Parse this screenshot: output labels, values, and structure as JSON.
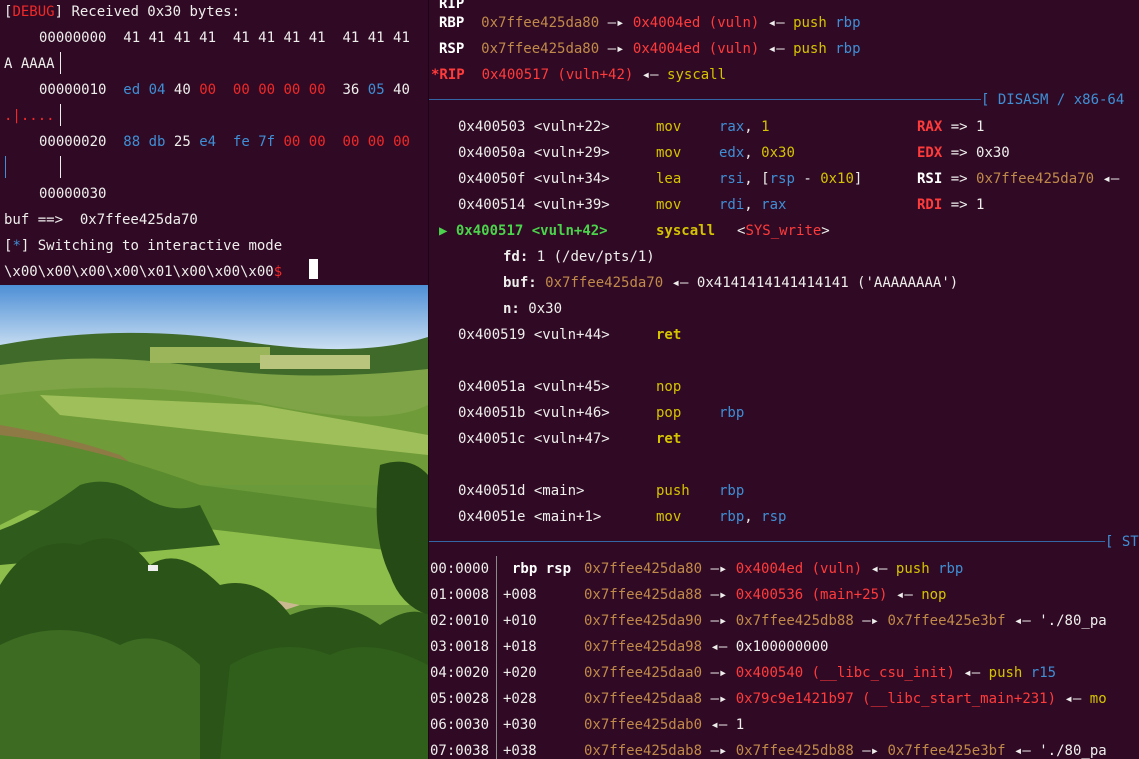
{
  "left_terminal": {
    "debug_open": "[",
    "debug_tag": "DEBUG",
    "debug_rest": "] Received 0x30 bytes:",
    "hex_lines": [
      {
        "offset": "00000000",
        "bytes": "41 41 41 41  41 41 41 41  41 41 41",
        "ascii": "A AAAA"
      },
      {
        "offset": "00000010",
        "b1": "ed 04",
        "b2": "40",
        "b3": "00",
        "b4": "00 00 00 00",
        "b5": "36",
        "b6": "05",
        "b7": "40",
        "ascii": ".|...."
      },
      {
        "offset": "00000020",
        "b1": "88 db",
        "b2": "25",
        "b3": "e4",
        "b4": "fe 7f",
        "b5": "00 00",
        "b6": "00 00 00"
      },
      {
        "offset": "00000030"
      }
    ],
    "buf_line": "buf ==>  0x7ffee425da70",
    "info_open": "[",
    "info_star": "*",
    "info_rest": "] Switching to interactive mode",
    "prompt_line": "\\x00\\x00\\x00\\x00\\x01\\x00\\x00\\x00",
    "prompt_sign": "$"
  },
  "right_terminal": {
    "registers": [
      {
        "name": "RBP",
        "addr": "0x7ffee425da80",
        "target": "0x4004ed (vuln)",
        "instr": "push",
        "arg": "rbp"
      },
      {
        "name": "RSP",
        "addr": "0x7ffee425da80",
        "target": "0x4004ed (vuln)",
        "instr": "push",
        "arg": "rbp"
      },
      {
        "name": "*RIP",
        "addr": "0x400517 (vuln+42)",
        "instr": "syscall"
      }
    ],
    "disasm_header": "[ DISASM / x86-64",
    "disasm": [
      {
        "addr": "0x400503",
        "sym": "<vuln+22>",
        "op": "mov",
        "args": "rax, 1",
        "reg": "RAX",
        "val": "1"
      },
      {
        "addr": "0x40050a",
        "sym": "<vuln+29>",
        "op": "mov",
        "args": "edx, 0x30",
        "reg": "EDX",
        "val": "0x30"
      },
      {
        "addr": "0x40050f",
        "sym": "<vuln+34>",
        "op": "lea",
        "args": "rsi, [rsp - 0x10]",
        "reg": "RSI",
        "val": "0x7ffee425da70"
      },
      {
        "addr": "0x400514",
        "sym": "<vuln+39>",
        "op": "mov",
        "args": "rdi, rax",
        "reg": "RDI",
        "val": "1"
      },
      {
        "addr": "0x400517",
        "sym": "<vuln+42>",
        "op": "syscall",
        "args": "<SYS_write>",
        "current": true
      },
      {
        "fd_label": "fd:",
        "fd_val": "1 (/dev/pts/1)"
      },
      {
        "buf_label": "buf:",
        "buf_addr": "0x7ffee425da70",
        "buf_val": "0x4141414141414141 ('AAAAAAAA')"
      },
      {
        "n_label": "n:",
        "n_val": "0x30"
      },
      {
        "addr": "0x400519",
        "sym": "<vuln+44>",
        "op": "ret"
      },
      {
        "addr": "0x40051a",
        "sym": "<vuln+45>",
        "op": "nop"
      },
      {
        "addr": "0x40051b",
        "sym": "<vuln+46>",
        "op": "pop",
        "args": "rbp"
      },
      {
        "addr": "0x40051c",
        "sym": "<vuln+47>",
        "op": "ret"
      },
      {
        "addr": "0x40051d",
        "sym": "<main>",
        "op": "push",
        "args": "rbp"
      },
      {
        "addr": "0x40051e",
        "sym": "<main+1>",
        "op": "mov",
        "args": "rbp, rsp"
      }
    ],
    "stack_header": "[ ST",
    "stack": [
      {
        "idx": "00:0000",
        "regs": "rbp rsp",
        "addr": "0x7ffee425da80",
        "t1": "0x4004ed (vuln)",
        "t2": "push rbp"
      },
      {
        "idx": "01:0008",
        "off": "+008",
        "addr": "0x7ffee425da88",
        "t1": "0x400536 (main+25)",
        "t2": "nop"
      },
      {
        "idx": "02:0010",
        "off": "+010",
        "addr": "0x7ffee425da90",
        "t1": "0x7ffee425db88",
        "t3": "0x7ffee425e3bf",
        "t4": "'./80_pa"
      },
      {
        "idx": "03:0018",
        "off": "+018",
        "addr": "0x7ffee425da98",
        "t5": "0x100000000"
      },
      {
        "idx": "04:0020",
        "off": "+020",
        "addr": "0x7ffee425daa0",
        "t1": "0x400540 (__libc_csu_init)",
        "t2": "push r15"
      },
      {
        "idx": "05:0028",
        "off": "+028",
        "addr": "0x7ffee425daa8",
        "t1": "0x79c9e1421b97 (__libc_start_main+231)",
        "t2": "mo"
      },
      {
        "idx": "06:0030",
        "off": "+030",
        "addr": "0x7ffee425dab0",
        "t5": "1"
      },
      {
        "idx": "07:0038",
        "off": "+038",
        "addr": "0x7ffee425dab8",
        "t1": "0x7ffee425db88",
        "t3": "0x7ffee425e3bf",
        "t4": "'./80_pa"
      }
    ],
    "arrow": "—▸",
    "larrow": "◂—",
    "ptr": "▶"
  }
}
